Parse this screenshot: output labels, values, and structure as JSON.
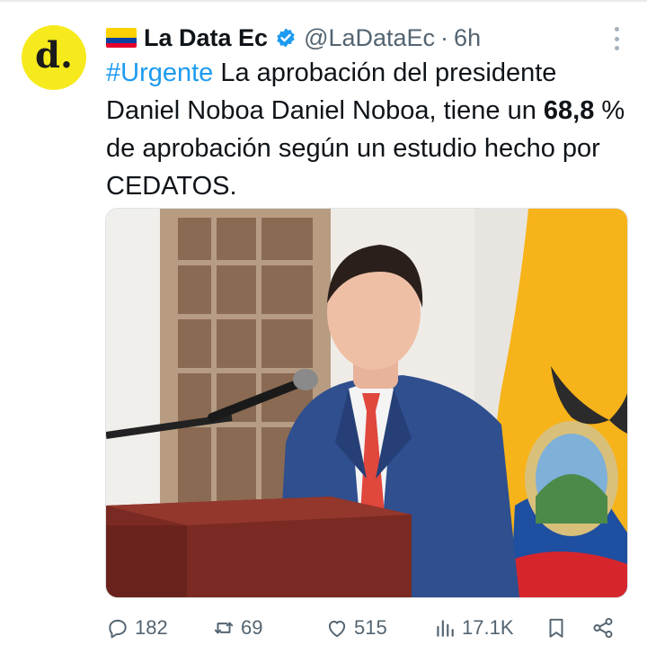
{
  "tweet": {
    "author_name": "La Data Ec",
    "handle": "@LaDataEc",
    "separator": "·",
    "time": "6h",
    "avatar_text": "d.",
    "text": {
      "hashtag": "#Urgente",
      "part1": " La aprobación del presidente Daniel Noboa Daniel Noboa, tiene un ",
      "bold_value": "68,8",
      "part2": " % de aprobación según un estudio hecho por CEDATOS."
    }
  },
  "actions": {
    "replies": "182",
    "reposts": "69",
    "likes": "515",
    "views": "17.1K"
  },
  "icons": [
    "flag-ecuador-icon",
    "verified-badge-icon",
    "more-options-icon",
    "reply-icon",
    "repost-icon",
    "like-icon",
    "views-icon",
    "bookmark-icon",
    "share-icon"
  ],
  "colors": {
    "accent": "#1d9bf0",
    "secondary_text": "#536471",
    "avatar_bg": "#f6ea1c"
  }
}
